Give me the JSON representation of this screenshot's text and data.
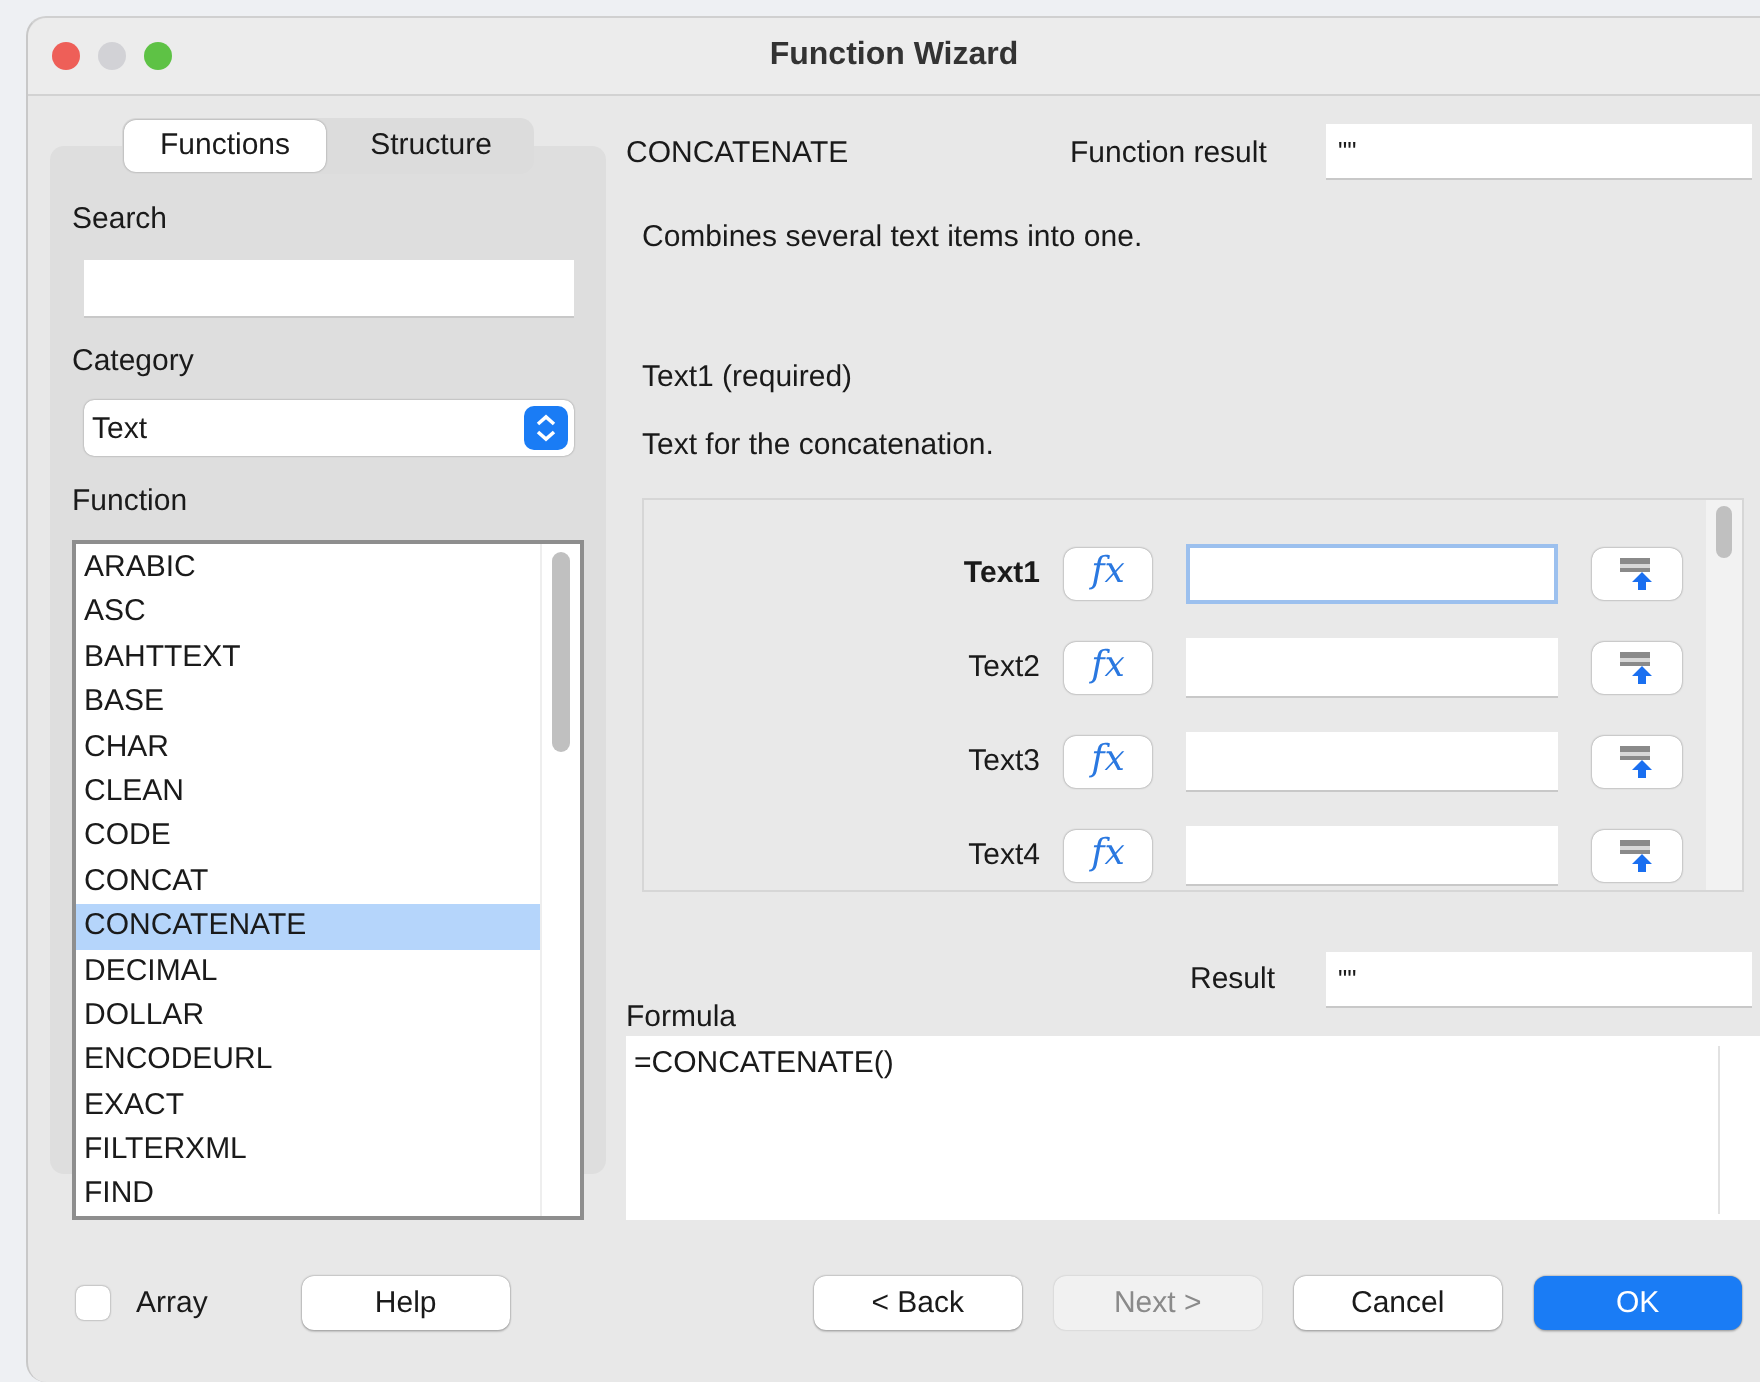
{
  "window": {
    "title": "Function Wizard"
  },
  "tabs": [
    {
      "label": "Functions",
      "selected": true
    },
    {
      "label": "Structure",
      "selected": false
    }
  ],
  "search": {
    "label": "Search"
  },
  "category": {
    "label": "Category",
    "value": "Text"
  },
  "function_list": {
    "label": "Function",
    "items": [
      {
        "label": "ARABIC",
        "selected": false
      },
      {
        "label": "ASC",
        "selected": false
      },
      {
        "label": "BAHTTEXT",
        "selected": false
      },
      {
        "label": "BASE",
        "selected": false
      },
      {
        "label": "CHAR",
        "selected": false
      },
      {
        "label": "CLEAN",
        "selected": false
      },
      {
        "label": "CODE",
        "selected": false
      },
      {
        "label": "CONCAT",
        "selected": false
      },
      {
        "label": "CONCATENATE",
        "selected": true
      },
      {
        "label": "DECIMAL",
        "selected": false
      },
      {
        "label": "DOLLAR",
        "selected": false
      },
      {
        "label": "ENCODEURL",
        "selected": false
      },
      {
        "label": "EXACT",
        "selected": false
      },
      {
        "label": "FILTERXML",
        "selected": false
      },
      {
        "label": "FIND",
        "selected": false
      }
    ]
  },
  "function_name": "CONCATENATE",
  "function_result": {
    "label": "Function result",
    "value": "\"\""
  },
  "description": "Combines several text items into one.",
  "argument_info": {
    "title": "Text1 (required)",
    "description": "Text for the concatenation."
  },
  "arguments": [
    {
      "label": "Text1",
      "function_button": "fx",
      "focused": true
    },
    {
      "label": "Text2",
      "function_button": "fx",
      "focused": false
    },
    {
      "label": "Text3",
      "function_button": "fx",
      "focused": false
    },
    {
      "label": "Text4",
      "function_button": "fx",
      "focused": false
    }
  ],
  "result": {
    "label": "Result",
    "value": "\"\""
  },
  "formula": {
    "label": "Formula",
    "value": "=CONCATENATE()"
  },
  "array": {
    "label": "Array",
    "checked": false
  },
  "buttons": [
    {
      "label": "Help",
      "kind": "normal",
      "disabled": false
    },
    {
      "label": "< Back",
      "kind": "normal",
      "disabled": false
    },
    {
      "label": "Next >",
      "kind": "normal",
      "disabled": true
    },
    {
      "label": "Cancel",
      "kind": "normal",
      "disabled": false
    },
    {
      "label": "OK",
      "kind": "default",
      "disabled": false
    }
  ]
}
